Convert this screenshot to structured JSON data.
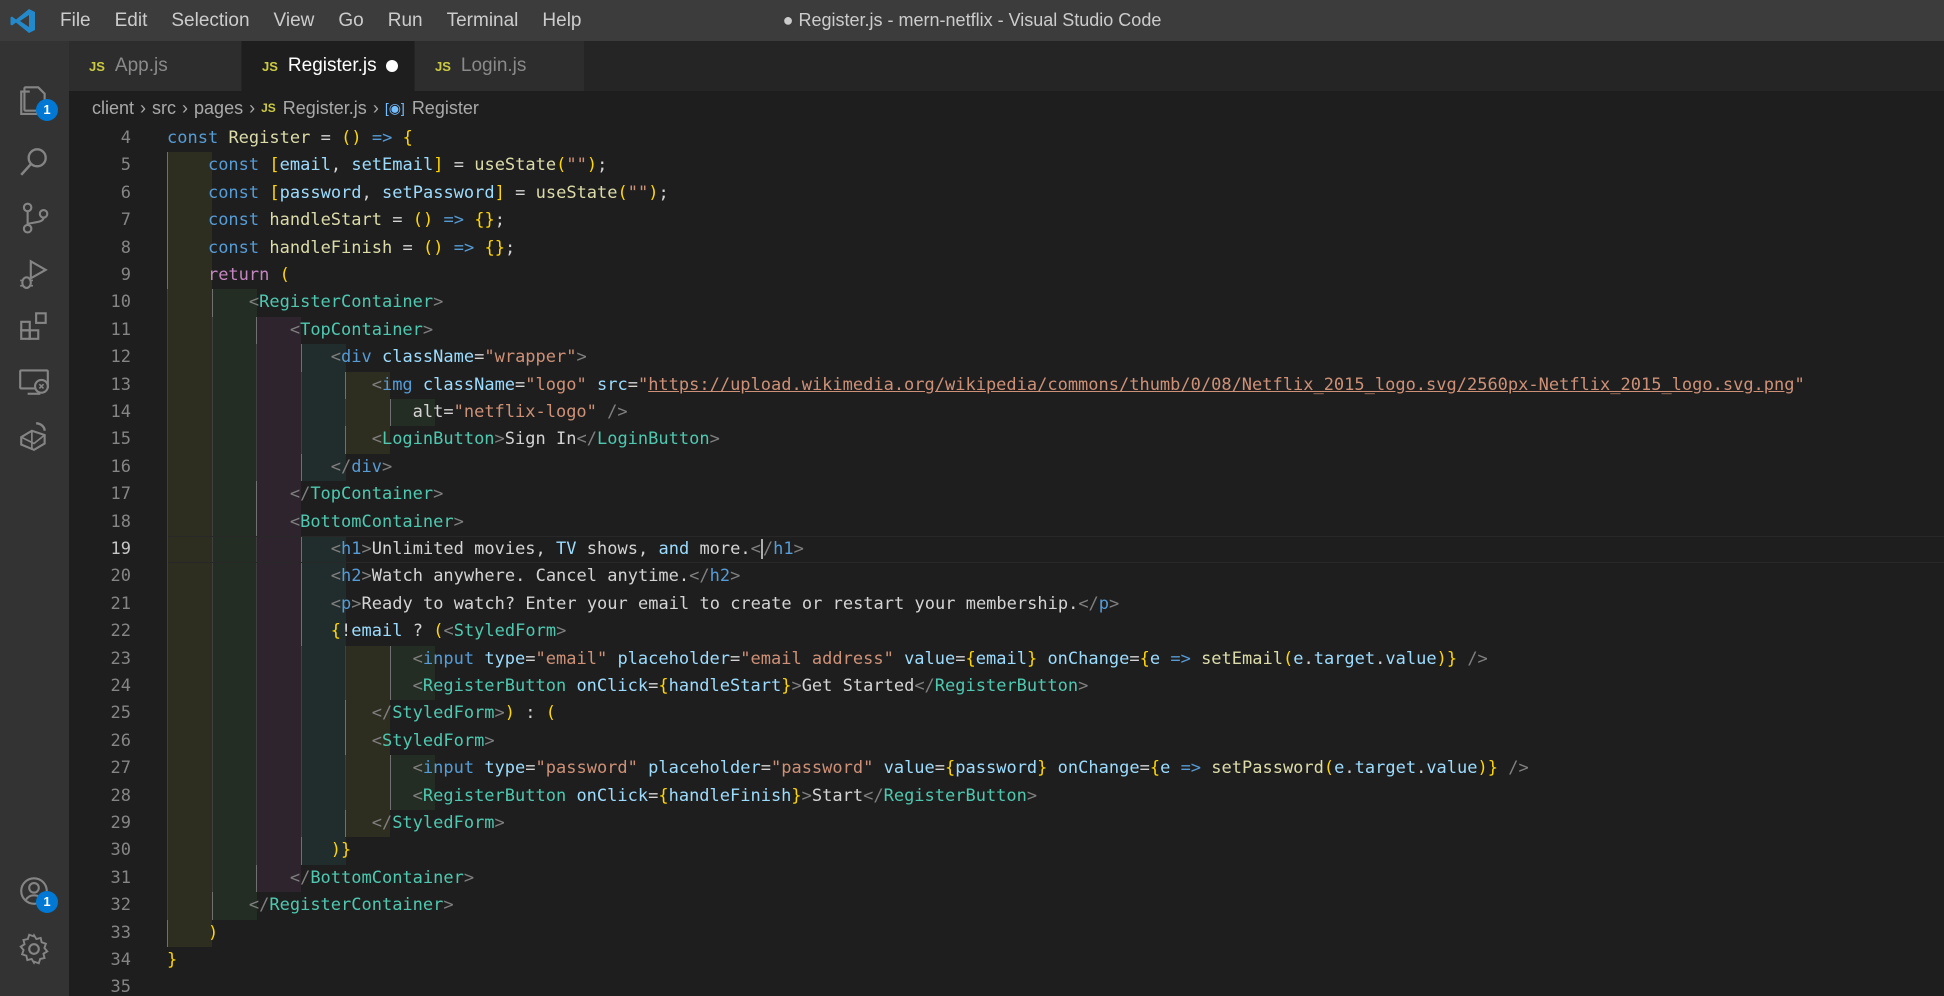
{
  "window": {
    "title": "● Register.js - mern-netflix - Visual Studio Code",
    "menu": [
      "File",
      "Edit",
      "Selection",
      "View",
      "Go",
      "Run",
      "Terminal",
      "Help"
    ]
  },
  "activity_bar": {
    "items": [
      {
        "name": "explorer-icon",
        "badge": "1"
      },
      {
        "name": "search-icon",
        "badge": ""
      },
      {
        "name": "source-control-icon",
        "badge": ""
      },
      {
        "name": "run-debug-icon",
        "badge": ""
      },
      {
        "name": "extensions-icon",
        "badge": ""
      },
      {
        "name": "remote-explorer-icon",
        "badge": ""
      },
      {
        "name": "docker-icon",
        "badge": ""
      }
    ],
    "bottom": [
      {
        "name": "accounts-icon",
        "badge": "1"
      },
      {
        "name": "settings-gear-icon",
        "badge": ""
      }
    ]
  },
  "tabs": [
    {
      "icon": "JS",
      "label": "App.js",
      "active": false,
      "dirty": false
    },
    {
      "icon": "JS",
      "label": "Register.js",
      "active": true,
      "dirty": true
    },
    {
      "icon": "JS",
      "label": "Login.js",
      "active": false,
      "dirty": false
    }
  ],
  "breadcrumb": {
    "parts": [
      "client",
      "src",
      "pages"
    ],
    "file_icon": "JS",
    "file": "Register.js",
    "symbol": "Register"
  },
  "editor": {
    "current_line": 19,
    "lines": [
      {
        "n": 4,
        "text": "const Register = () => {"
      },
      {
        "n": 5,
        "text": "    const [email, setEmail] = useState(\"\");"
      },
      {
        "n": 6,
        "text": "    const [password, setPassword] = useState(\"\");"
      },
      {
        "n": 7,
        "text": "    const handleStart = () => {};"
      },
      {
        "n": 8,
        "text": "    const handleFinish = () => {};"
      },
      {
        "n": 9,
        "text": "    return ("
      },
      {
        "n": 10,
        "text": "        <RegisterContainer>"
      },
      {
        "n": 11,
        "text": "            <TopContainer>"
      },
      {
        "n": 12,
        "text": "                <div className=\"wrapper\">"
      },
      {
        "n": 13,
        "text": "                    <img className=\"logo\" src=\"https://upload.wikimedia.org/wikipedia/commons/thumb/0/08/Netflix_2015_logo.svg/2560px-Netflix_2015_logo.svg.png\""
      },
      {
        "n": 14,
        "text": "                        alt=\"netflix-logo\" />"
      },
      {
        "n": 15,
        "text": "                    <LoginButton>Sign In</LoginButton>"
      },
      {
        "n": 16,
        "text": "                </div>"
      },
      {
        "n": 17,
        "text": "            </TopContainer>"
      },
      {
        "n": 18,
        "text": "            <BottomContainer>"
      },
      {
        "n": 19,
        "text": "                <h1>Unlimited movies, TV shows, and more.</h1>"
      },
      {
        "n": 20,
        "text": "                <h2>Watch anywhere. Cancel anytime.</h2>"
      },
      {
        "n": 21,
        "text": "                <p>Ready to watch? Enter your email to create or restart your membership.</p>"
      },
      {
        "n": 22,
        "text": "                {!email ? (<StyledForm>"
      },
      {
        "n": 23,
        "text": "                        <input type=\"email\" placeholder=\"email address\" value={email} onChange={e => setEmail(e.target.value)} />"
      },
      {
        "n": 24,
        "text": "                        <RegisterButton onClick={handleStart}>Get Started</RegisterButton>"
      },
      {
        "n": 25,
        "text": "                    </StyledForm>) : ("
      },
      {
        "n": 26,
        "text": "                    <StyledForm>"
      },
      {
        "n": 27,
        "text": "                        <input type=\"password\" placeholder=\"password\" value={password} onChange={e => setPassword(e.target.value)} />"
      },
      {
        "n": 28,
        "text": "                        <RegisterButton onClick={handleFinish}>Start</RegisterButton>"
      },
      {
        "n": 29,
        "text": "                    </StyledForm>"
      },
      {
        "n": 30,
        "text": "                )}"
      },
      {
        "n": 31,
        "text": "            </BottomContainer>"
      },
      {
        "n": 32,
        "text": "        </RegisterContainer>"
      },
      {
        "n": 33,
        "text": "    )"
      },
      {
        "n": 34,
        "text": "}"
      },
      {
        "n": 35,
        "text": ""
      }
    ]
  },
  "colors": {
    "keyword": "#569cd6",
    "control": "#c586c0",
    "variable": "#9cdcfe",
    "function": "#dcdcaa",
    "string": "#ce9178",
    "component": "#4ec9b0",
    "punctuation": "#808080",
    "bracket_pair_1": "#ffd700",
    "bracket_pair_2": "#da70d6",
    "bracket_pair_3": "#179fff",
    "badge": "#0078d4"
  }
}
